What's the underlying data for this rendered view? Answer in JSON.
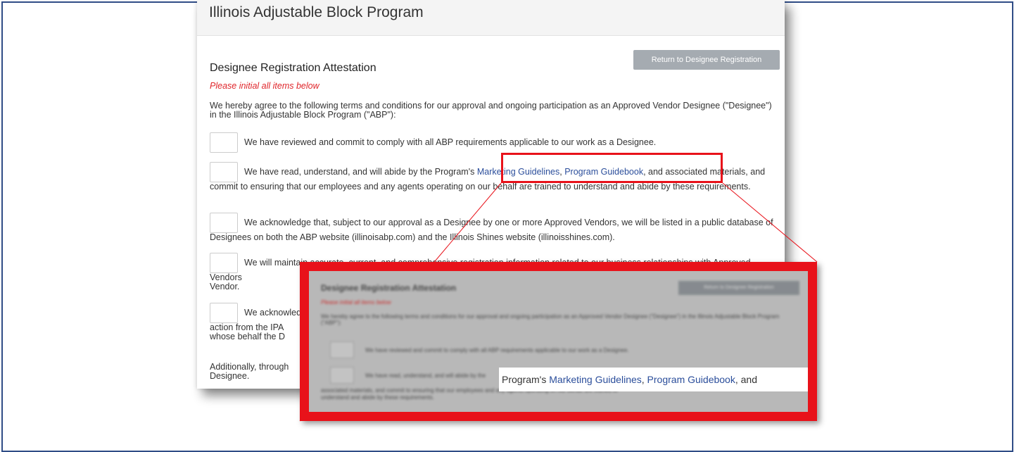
{
  "panel": {
    "title": "Illinois Adjustable Block Program",
    "return_button": "Return to Designee Registration",
    "section_title": "Designee Registration Attestation",
    "instruction": "Please initial all items below",
    "intro": "We hereby agree to the following terms and conditions for our approval and ongoing participation as an Approved Vendor Designee (\"Designee\") in the Illinois Adjustable Block Program (\"ABP\"):",
    "items": [
      {
        "text": "We have reviewed and commit to comply with all ABP requirements applicable to our work as a Designee."
      },
      {
        "before": "We have read, understand, and will abide by the Program's ",
        "link1": "Marketing Guidelines",
        "sep": ", ",
        "link2": "Program Guidebook",
        "after": ", and associated materials, and commit to ensuring that our employees and any agents operating on our behalf are trained to understand and abide by these requirements."
      },
      {
        "text": "We acknowledge that, subject to our approval as a Designee by one or more Approved Vendors, we will be listed in a public database of Designees on both the ABP website (illinoisabp.com) and the Illinois Shines website (illinoisshines.com)."
      },
      {
        "text": "We will maintain accurate, current, and comprehensive registration information related to our business relationships with Approved Vendors",
        "text2": "Vendor."
      },
      {
        "text": "We acknowledge",
        "line2": "action from the IPA",
        "line3": "whose behalf the D"
      }
    ],
    "additionally": "Additionally, through",
    "additionally2": "Designee."
  },
  "zoom": {
    "crisp_before": "Program's ",
    "crisp_link1": "Marketing Guidelines",
    "crisp_sep": ", ",
    "crisp_link2": "Program Guidebook",
    "crisp_after": ", and",
    "blur_title": "Designee Registration Attestation",
    "blur_instruction": "Please initial all items below",
    "blur_intro": "We hereby agree to the following terms and conditions for our approval and ongoing participation as an Approved Vendor Designee (\"Designee\") in the Illinois Adjustable Block Program (\"ABP\"):",
    "blur_item1": "We have reviewed and commit to comply with all ABP requirements applicable to our work as a Designee.",
    "blur_item2": "We have read, understand, and will abide by the",
    "blur_item2b": "associated materials, and commit to ensuring that our employees and any agents operating on our behalf are trained to",
    "blur_item2c": "understand and abide by these requirements.",
    "blur_button": "Return to Designee Registration"
  },
  "colors": {
    "accent_red": "#e8121a",
    "link_blue": "#2b4e9b",
    "frame_blue": "#2f4c86"
  }
}
